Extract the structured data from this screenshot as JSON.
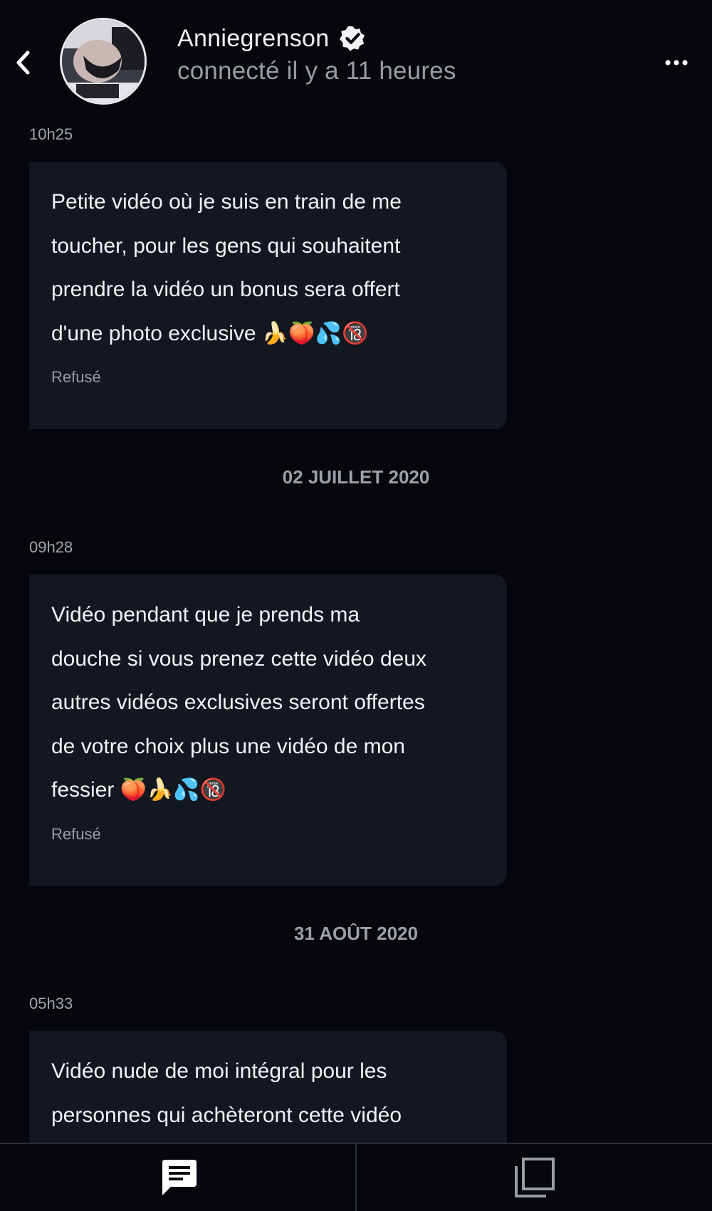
{
  "header": {
    "back_icon": "chevron-left-icon",
    "name": "Anniegrenson",
    "verified_icon": "verified-badge-icon",
    "status": "connecté il y a 11 heures",
    "more_icon": "more-horizontal-icon"
  },
  "messages": [
    {
      "time": "10h25",
      "text": "Petite vidéo où je suis en train de me\ntoucher, pour les gens qui souhaitent\nprendre la vidéo un bonus sera offert\nd'une photo exclusive 🍌🍑💦🔞",
      "status": "Refusé"
    },
    {
      "time": "09h28",
      "text": "Vidéo pendant que je prends ma\ndouche si vous prenez cette vidéo deux\nautres vidéos exclusives seront offertes\nde votre choix plus une vidéo de mon\nfessier 🍑🍌💦🔞",
      "status": "Refusé"
    },
    {
      "time": "05h33",
      "text": "Vidéo nude de moi intégral pour les\npersonnes qui achèteront cette vidéo",
      "status": ""
    }
  ],
  "date_separators": [
    "02 JUILLET 2020",
    "31 AOÛT 2020"
  ],
  "bottom_nav": {
    "messages_icon": "chat-message-icon",
    "gallery_icon": "gallery-stack-icon"
  },
  "colors": {
    "background": "#05070c",
    "bubble": "#131720",
    "text_primary": "#f2f2f4",
    "text_secondary": "#9a9ca4"
  }
}
